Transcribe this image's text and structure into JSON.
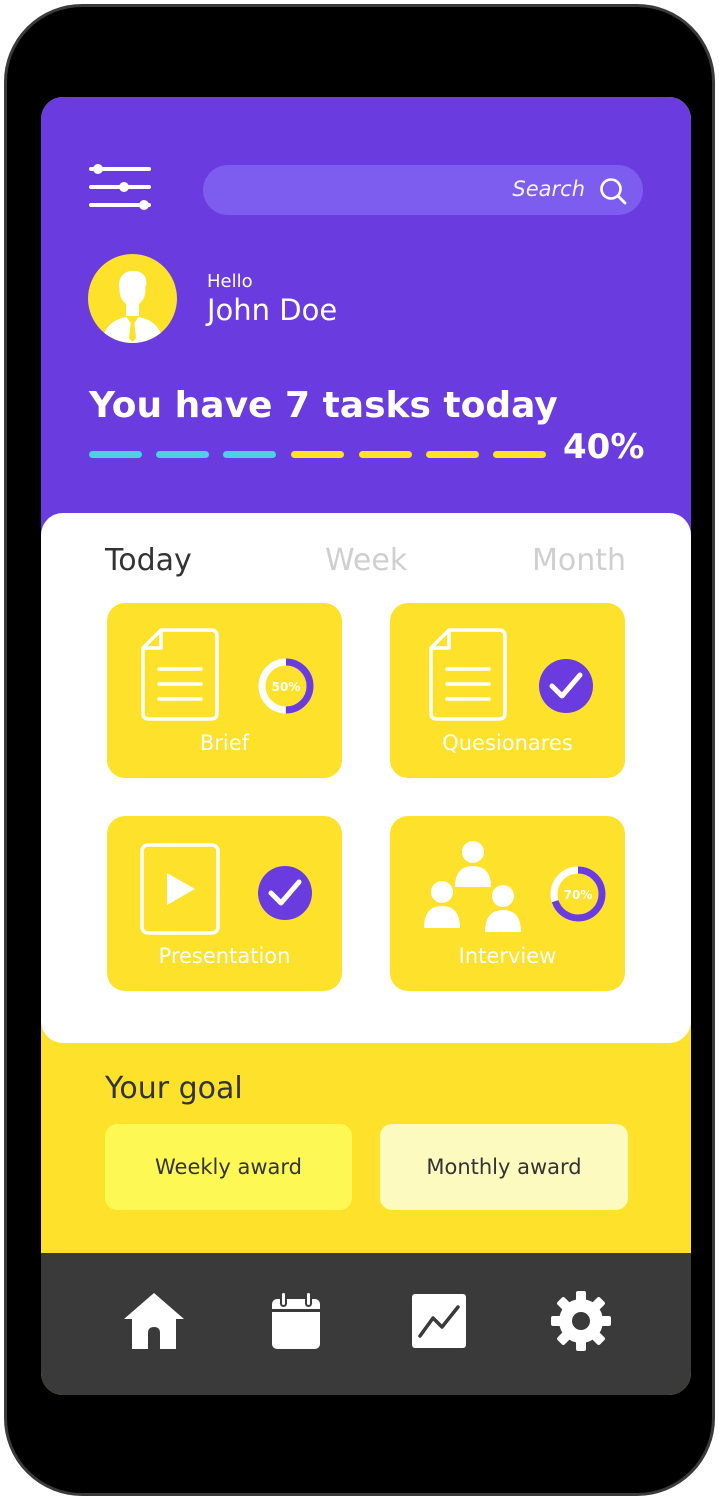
{
  "search": {
    "placeholder": "Search"
  },
  "user": {
    "greeting": "Hello",
    "name": "John Doe"
  },
  "tasks": {
    "title": "You have 7 tasks today",
    "progress_label": "40%",
    "progress_fraction": 0.4,
    "segments_total": 7,
    "segments_done": 3
  },
  "tabs": [
    {
      "label": "Today",
      "active": true
    },
    {
      "label": "Week",
      "active": false
    },
    {
      "label": "Month",
      "active": false
    }
  ],
  "task_tiles": [
    {
      "label": "Brief",
      "icon": "document-icon",
      "status": "progress",
      "progress_label": "50%",
      "progress_fraction": 0.5
    },
    {
      "label": "Quesionares",
      "icon": "document-icon",
      "status": "done"
    },
    {
      "label": "Presentation",
      "icon": "play-icon",
      "status": "done"
    },
    {
      "label": "Interview",
      "icon": "people-icon",
      "status": "progress",
      "progress_label": "70%",
      "progress_fraction": 0.7
    }
  ],
  "goal": {
    "title": "Your goal",
    "awards": [
      {
        "label": "Weekly award"
      },
      {
        "label": "Monthly award"
      }
    ]
  },
  "nav": [
    {
      "icon": "home-icon"
    },
    {
      "icon": "calendar-icon"
    },
    {
      "icon": "chart-icon"
    },
    {
      "icon": "gear-icon"
    }
  ],
  "colors": {
    "purple": "#6a3cdf",
    "search_bg": "#7d5cf0",
    "yellow": "#fde12a",
    "cyan": "#4dd0e1",
    "check_purple": "#6a3cdf",
    "nav_bg": "#3a3a3a"
  }
}
